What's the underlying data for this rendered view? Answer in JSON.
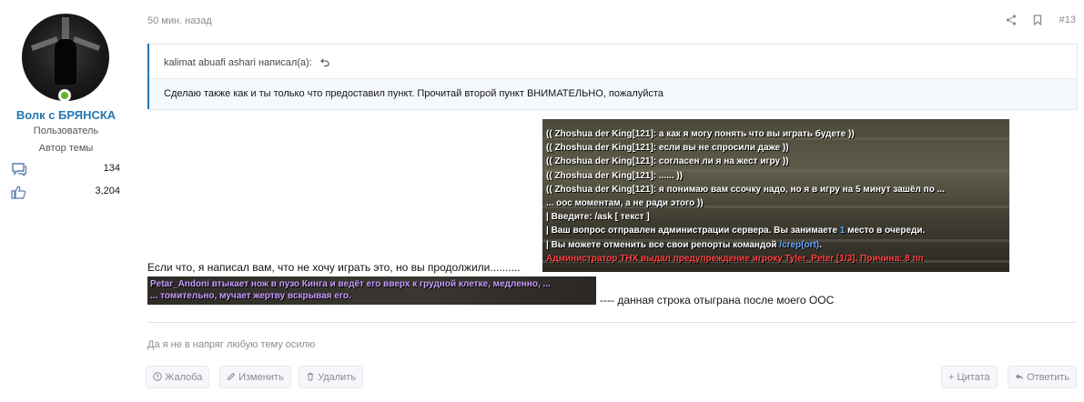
{
  "user": {
    "name": "Волк с БРЯНСКА",
    "title": "Пользователь",
    "banner": "Автор темы",
    "messages": "134",
    "reactions": "3,204"
  },
  "post": {
    "time": "50 мин. назад",
    "number": "#13",
    "quote": {
      "author": "kalimat abuafi ashari написал(а):",
      "text": "Сделаю также как и ты только что предоставил пункт. Прочитай второй пункт ВНИМАТЕЛЬНО, пожалуйста"
    },
    "screenshot_chat": [
      {
        "text": "(( Zhoshua der King[121]: а как я могу понять что вы играть будете ))"
      },
      {
        "text": "(( Zhoshua der King[121]: если вы не спросили даже ))"
      },
      {
        "text": "(( Zhoshua der King[121]: согласен ли я на жест игру ))"
      },
      {
        "text": "(( Zhoshua der King[121]: ...... ))"
      },
      {
        "text": "(( Zhoshua der King[121]: я понимаю вам ссочку надо, но  я в игру на 5 минут зашёл по ..."
      },
      {
        "text": "... оос моментам, а не ради этого ))"
      },
      {
        "text": "| Введите: /ask [ текст ]"
      },
      {
        "text_pre": "| Ваш вопрос отправлен администрации сервера. Вы занимаете ",
        "highlight": "1",
        "text_post": " место в очереди."
      },
      {
        "text_pre": "| Вы можете отменить все свои репорты командой ",
        "highlight": "/crep(ort)",
        "text_post": "."
      },
      {
        "text": "Администратор THX выдал предупреждение игроку Tyler_Peter [1/3]. Причина: 8 пп",
        "red": true
      }
    ],
    "body_text": "Если что, я написал вам, что не хочу играть это, но вы продолжили..........",
    "screenshot_me": [
      "Petar_Andoni втыкает нож в пузо Кинга и ведёт его вверх к грудной клетке, медленно, ...",
      "... томительно, мучает жертву вскрывая его."
    ],
    "after_text": "---- данная строка отыграна после моего ООС",
    "signature": "Да я не в напряг любую тему осилю"
  },
  "buttons": {
    "report": "Жалоба",
    "edit": "Изменить",
    "delete": "Удалить",
    "quote": "Цитата",
    "reply": "Ответить"
  },
  "colors": {
    "accent": "#2577b1",
    "online": "#63b521",
    "muted": "#8c8c8c",
    "warning_red": "#ff4343"
  }
}
